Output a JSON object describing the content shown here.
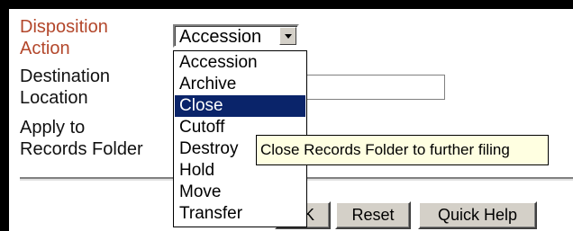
{
  "form": {
    "disposition_label": "Disposition\nAction",
    "destination_label": "Destination\nLocation",
    "apply_label": "Apply to\nRecords Folder",
    "select": {
      "value": "Accession",
      "options": [
        "Accession",
        "Archive",
        "Close",
        "Cutoff",
        "Destroy",
        "Hold",
        "Move",
        "Transfer"
      ],
      "highlighted": "Close"
    },
    "destination_value": "",
    "tooltip": "Close Records Folder to further filing"
  },
  "buttons": {
    "ok_label": "OK",
    "reset_label": "Reset",
    "help_label": "Quick Help"
  },
  "colors": {
    "label_accent": "#b3472b",
    "selection": "#0a246a",
    "tooltip_bg": "#ffffe1"
  }
}
